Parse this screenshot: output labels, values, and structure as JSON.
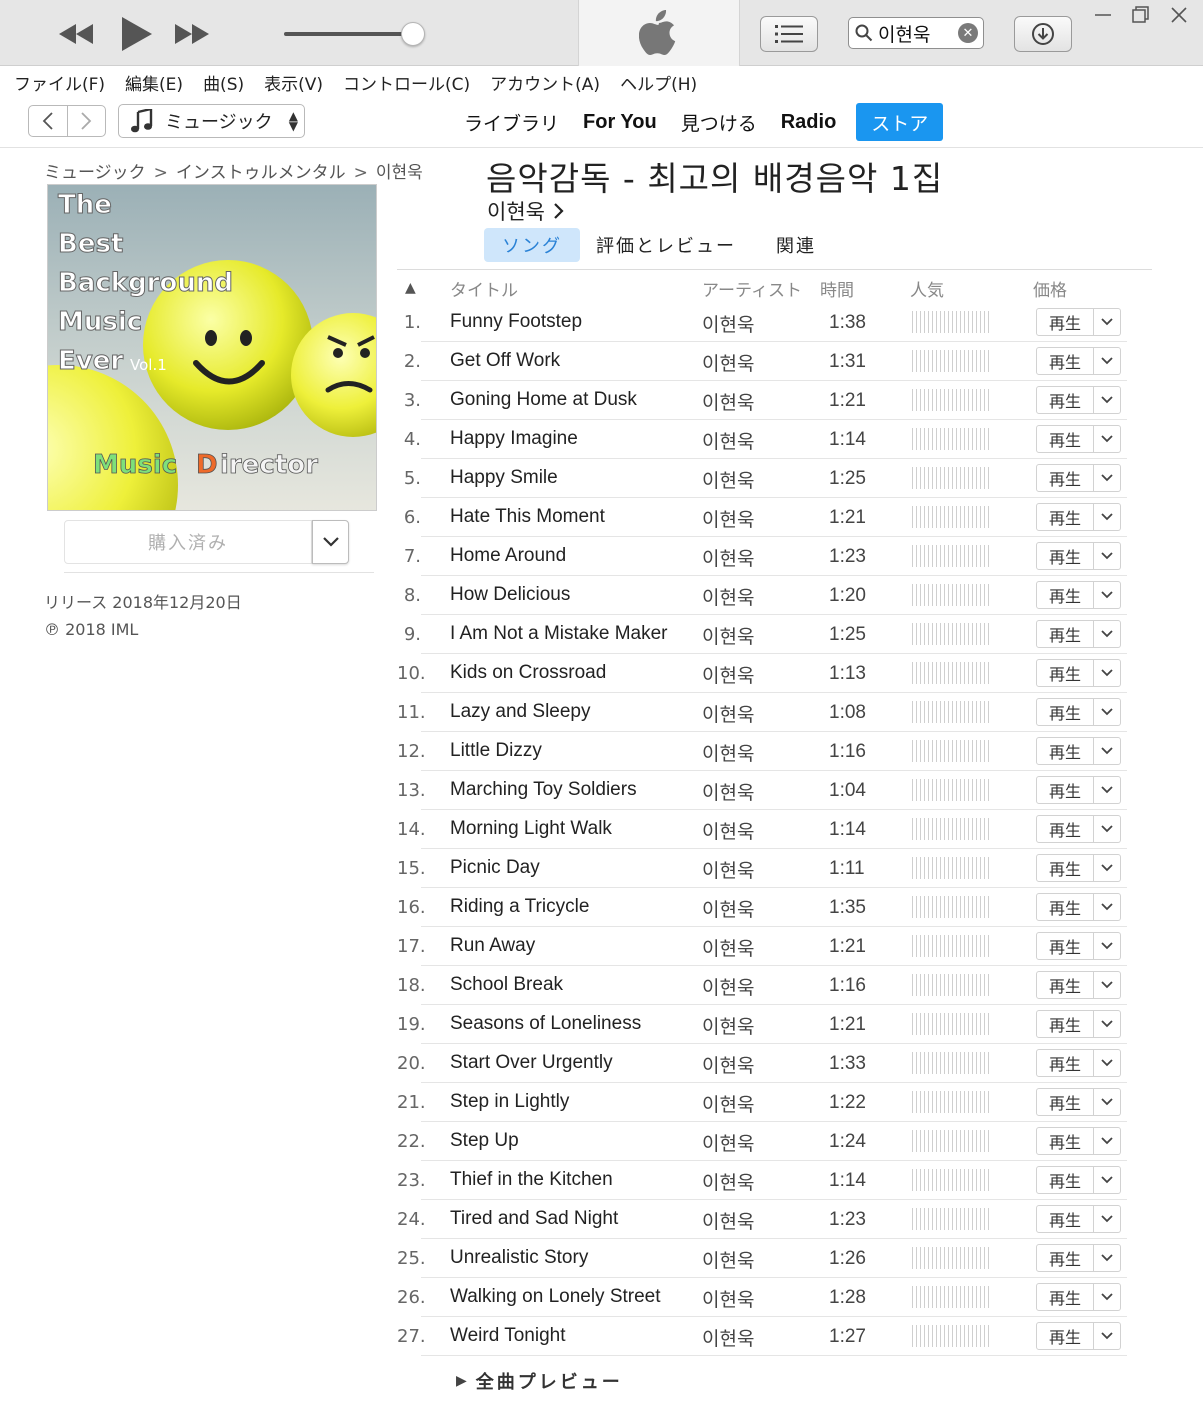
{
  "player": {
    "prev_icon": "rewind-icon",
    "play_icon": "play-icon",
    "next_icon": "fast-forward-icon",
    "volume": 0.92,
    "search_value": "이현욱"
  },
  "menu": [
    "ファイル(F)",
    "編集(E)",
    "曲(S)",
    "表示(V)",
    "コントロール(C)",
    "アカウント(A)",
    "ヘルプ(H)"
  ],
  "nav": {
    "media_label": "ミュージック",
    "tabs": [
      "ライブラリ",
      "For You",
      "見つける",
      "Radio",
      "ストア"
    ],
    "active_tab": "ストア"
  },
  "breadcrumb": [
    "ミュージック",
    "インストゥルメンタル",
    "이현욱"
  ],
  "breadcrumb_sep": ">",
  "cover": {
    "line1": "The",
    "line2": "Best",
    "line3": "Background",
    "line4": "Music",
    "line5": "Ever",
    "vol": "Vol.1",
    "brand_a": "Music",
    "brand_b": "D",
    "brand_c": "irector"
  },
  "purchase_label": "購入済み",
  "release": {
    "date": "リリース 2018年12月20日",
    "copyright": "℗ 2018 IML"
  },
  "album": {
    "title": "음악감독 - 최고의 배경음악 1집",
    "artist": "이현욱",
    "subtabs": [
      "ソング",
      "評価とレビュー",
      "関連"
    ]
  },
  "table": {
    "headers": {
      "sort": "▲",
      "title": "タイトル",
      "artist": "アーティスト",
      "time": "時間",
      "popularity": "人気",
      "price": "価格"
    },
    "play_label": "再生",
    "rows": [
      {
        "num": "1.",
        "title": "Funny Footstep",
        "artist": "이현욱",
        "time": "1:38"
      },
      {
        "num": "2.",
        "title": "Get Off Work",
        "artist": "이현욱",
        "time": "1:31"
      },
      {
        "num": "3.",
        "title": "Goning Home at Dusk",
        "artist": "이현욱",
        "time": "1:21"
      },
      {
        "num": "4.",
        "title": "Happy Imagine",
        "artist": "이현욱",
        "time": "1:14"
      },
      {
        "num": "5.",
        "title": "Happy Smile",
        "artist": "이현욱",
        "time": "1:25"
      },
      {
        "num": "6.",
        "title": "Hate This Moment",
        "artist": "이현욱",
        "time": "1:21"
      },
      {
        "num": "7.",
        "title": "Home Around",
        "artist": "이현욱",
        "time": "1:23"
      },
      {
        "num": "8.",
        "title": "How Delicious",
        "artist": "이현욱",
        "time": "1:20"
      },
      {
        "num": "9.",
        "title": "I Am Not a Mistake Maker",
        "artist": "이현욱",
        "time": "1:25"
      },
      {
        "num": "10.",
        "title": "Kids on Crossroad",
        "artist": "이현욱",
        "time": "1:13"
      },
      {
        "num": "11.",
        "title": "Lazy and Sleepy",
        "artist": "이현욱",
        "time": "1:08"
      },
      {
        "num": "12.",
        "title": "Little Dizzy",
        "artist": "이현욱",
        "time": "1:16"
      },
      {
        "num": "13.",
        "title": "Marching Toy Soldiers",
        "artist": "이현욱",
        "time": "1:04"
      },
      {
        "num": "14.",
        "title": "Morning Light Walk",
        "artist": "이현욱",
        "time": "1:14"
      },
      {
        "num": "15.",
        "title": "Picnic Day",
        "artist": "이현욱",
        "time": "1:11"
      },
      {
        "num": "16.",
        "title": "Riding a Tricycle",
        "artist": "이현욱",
        "time": "1:35"
      },
      {
        "num": "17.",
        "title": "Run Away",
        "artist": "이현욱",
        "time": "1:21"
      },
      {
        "num": "18.",
        "title": "School Break",
        "artist": "이현욱",
        "time": "1:16"
      },
      {
        "num": "19.",
        "title": "Seasons of Loneliness",
        "artist": "이현욱",
        "time": "1:21"
      },
      {
        "num": "20.",
        "title": "Start Over Urgently",
        "artist": "이현욱",
        "time": "1:33"
      },
      {
        "num": "21.",
        "title": "Step in Lightly",
        "artist": "이현욱",
        "time": "1:22"
      },
      {
        "num": "22.",
        "title": "Step Up",
        "artist": "이현욱",
        "time": "1:24"
      },
      {
        "num": "23.",
        "title": "Thief in the Kitchen",
        "artist": "이현욱",
        "time": "1:14"
      },
      {
        "num": "24.",
        "title": "Tired and Sad Night",
        "artist": "이현욱",
        "time": "1:23"
      },
      {
        "num": "25.",
        "title": "Unrealistic Story",
        "artist": "이현욱",
        "time": "1:26"
      },
      {
        "num": "26.",
        "title": "Walking on Lonely Street",
        "artist": "이현욱",
        "time": "1:28"
      },
      {
        "num": "27.",
        "title": "Weird Tonight",
        "artist": "이현욱",
        "time": "1:27"
      }
    ]
  },
  "preview_all_label": "全曲プレビュー",
  "colors": {
    "accent": "#1a96f0",
    "subtab_bg": "#cfe6fb",
    "subtab_text": "#2a82d6"
  }
}
